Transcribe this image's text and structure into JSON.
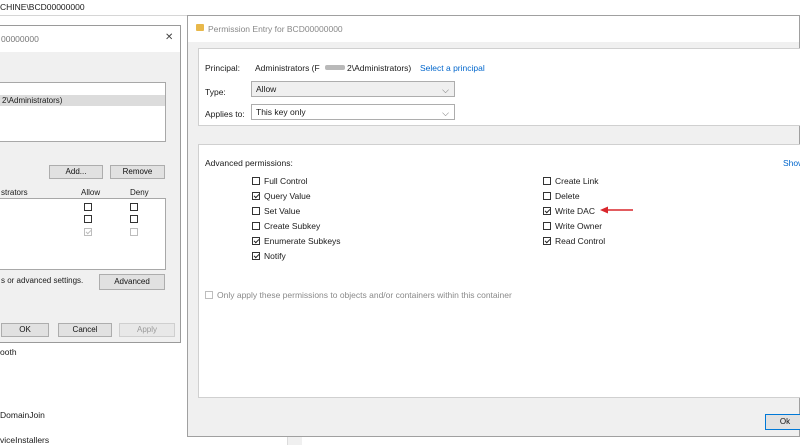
{
  "address_bar": {
    "path": "CHINE\\BCD00000000"
  },
  "left_tree": {
    "items": [
      "ooth",
      "DomainJoin",
      "viceInstallers"
    ]
  },
  "security_dialog": {
    "title": "00000000",
    "principal_row": "2\\Administrators)",
    "add_label": "Add...",
    "remove_label": "Remove",
    "permissions_header": "strators",
    "allow_header": "Allow",
    "deny_header": "Deny",
    "advanced_note": "s or advanced settings.",
    "advanced_label": "Advanced",
    "ok_label": "OK",
    "cancel_label": "Cancel",
    "apply_label": "Apply",
    "close_glyph": "✕"
  },
  "permission_entry": {
    "title": "Permission Entry for BCD00000000",
    "principal_label": "Principal:",
    "principal_value": "Administrators (F",
    "principal_value_tail": "2\\Administrators)",
    "select_principal": "Select a principal",
    "type_label": "Type:",
    "type_value": "Allow",
    "applies_label": "Applies to:",
    "applies_value": "This key only",
    "advanced_permissions_label": "Advanced permissions:",
    "show_link": "Show",
    "left_permissions": [
      {
        "label": "Full Control",
        "checked": false
      },
      {
        "label": "Query Value",
        "checked": true
      },
      {
        "label": "Set Value",
        "checked": false
      },
      {
        "label": "Create Subkey",
        "checked": false
      },
      {
        "label": "Enumerate Subkeys",
        "checked": true
      },
      {
        "label": "Notify",
        "checked": true
      }
    ],
    "right_permissions": [
      {
        "label": "Create Link",
        "checked": false
      },
      {
        "label": "Delete",
        "checked": false
      },
      {
        "label": "Write DAC",
        "checked": true
      },
      {
        "label": "Write Owner",
        "checked": false
      },
      {
        "label": "Read Control",
        "checked": true
      }
    ],
    "only_apply_label": "Only apply these permissions to objects and/or containers within this container",
    "ok_label": "Ok",
    "accent_link_color": "#0066cc",
    "annotation_arrow_color": "#d9262c"
  }
}
